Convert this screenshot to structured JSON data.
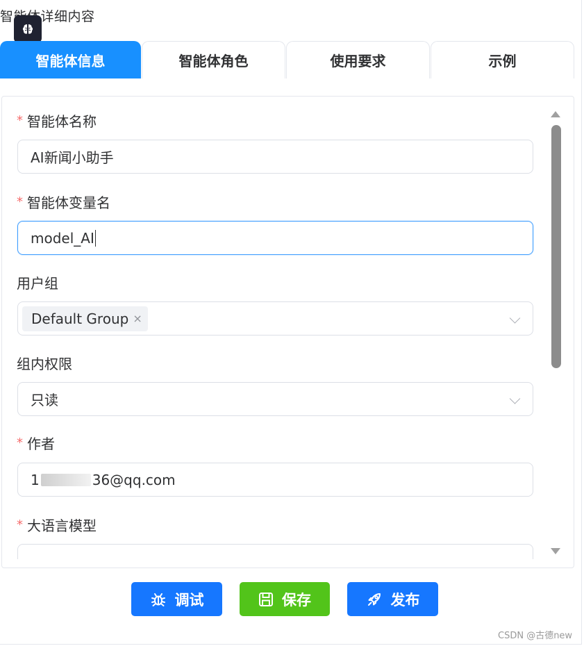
{
  "panel": {
    "title": "智能体详细内容"
  },
  "tabs": [
    {
      "label": "智能体信息",
      "active": true
    },
    {
      "label": "智能体角色",
      "active": false
    },
    {
      "label": "使用要求",
      "active": false
    },
    {
      "label": "示例",
      "active": false
    }
  ],
  "form": {
    "required_mark": "*",
    "agent_name": {
      "label": "智能体名称",
      "value": "AI新闻小助手"
    },
    "variable_name": {
      "label": "智能体变量名",
      "value": "model_AI"
    },
    "user_group": {
      "label": "用户组",
      "tag": "Default Group",
      "tag_close": "×"
    },
    "permission": {
      "label": "组内权限",
      "value": "只读"
    },
    "author": {
      "label": "作者",
      "value_prefix": "1",
      "value_suffix": "36@qq.com"
    },
    "llm": {
      "label": "大语言模型",
      "value": ""
    }
  },
  "buttons": {
    "debug": "调试",
    "save": "保存",
    "publish": "发布"
  },
  "watermark": "CSDN @古德new",
  "colors": {
    "primary": "#1890ff",
    "button_blue": "#1677ff",
    "button_green": "#52c41a",
    "required": "#f56c6c",
    "focus_border": "#409eff"
  }
}
